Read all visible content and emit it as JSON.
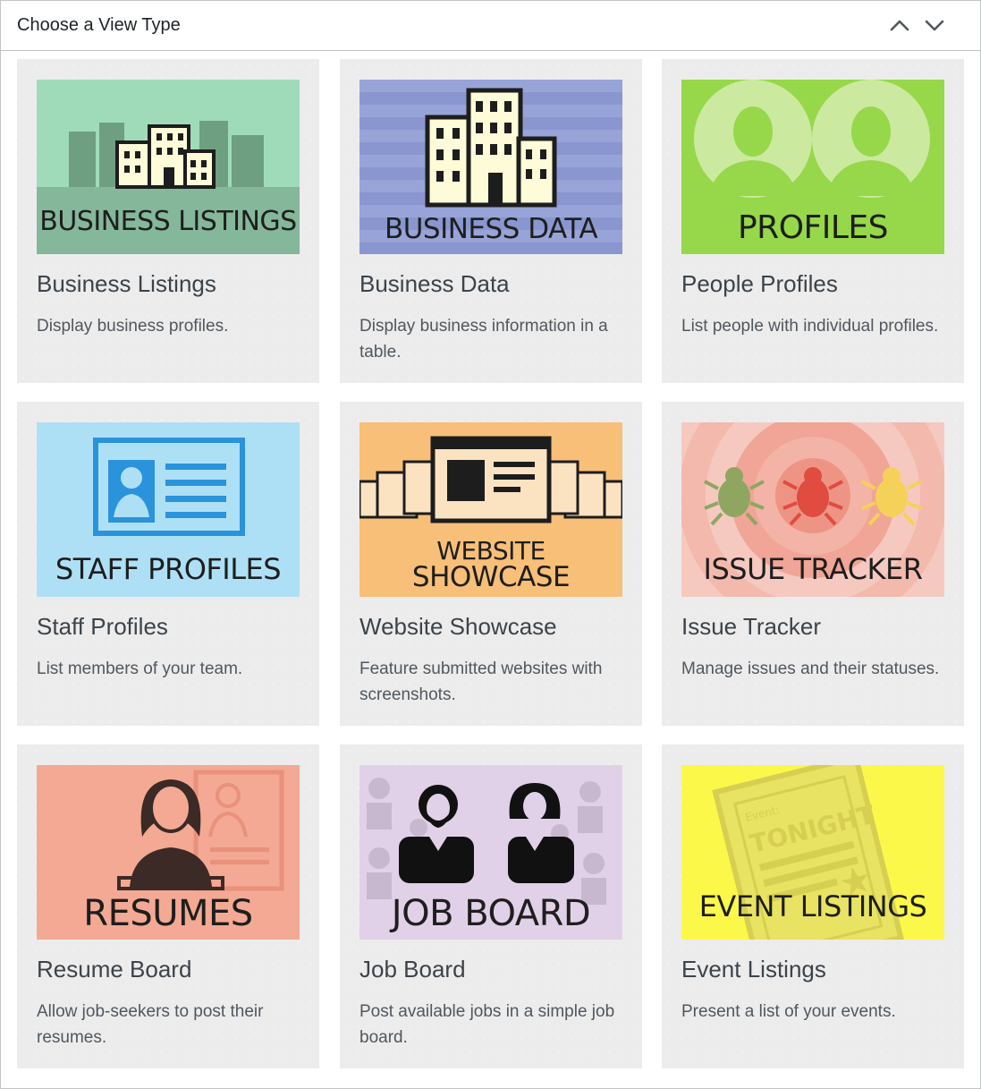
{
  "header": {
    "title": "Choose a View Type",
    "collapse_up_icon": "chevron-up-icon",
    "collapse_down_icon": "chevron-down-icon"
  },
  "cards": [
    {
      "thumb_label": "BUSINESS LISTINGS",
      "title": "Business Listings",
      "desc": "Display business profiles.",
      "bg": "#9fdbb8"
    },
    {
      "thumb_label": "BUSINESS DATA",
      "title": "Business Data",
      "desc": "Display business information in a table.",
      "bg": "#8a96cf"
    },
    {
      "thumb_label": "PROFILES",
      "title": "People Profiles",
      "desc": "List people with individual profiles.",
      "bg": "#96d84a"
    },
    {
      "thumb_label": "STAFF PROFILES",
      "title": "Staff Profiles",
      "desc": "List members of your team.",
      "bg": "#aee0f5"
    },
    {
      "thumb_label_1": "WEBSITE",
      "thumb_label_2": "SHOWCASE",
      "title": "Website Showcase",
      "desc": "Feature submitted websites with screenshots.",
      "bg": "#f8bf78"
    },
    {
      "thumb_label": "ISSUE TRACKER",
      "title": "Issue Tracker",
      "desc": "Manage issues and their statuses.",
      "bg": "#f6c9c0"
    },
    {
      "thumb_label": "RESUMES",
      "title": "Resume Board",
      "desc": "Allow job-seekers to post their resumes.",
      "bg": "#f3a993"
    },
    {
      "thumb_label": "JOB BOARD",
      "title": "Job Board",
      "desc": "Post available jobs in a simple job board.",
      "bg": "#e1d1e8"
    },
    {
      "thumb_label": "EVENT LISTINGS",
      "thumb_sub_1": "Event:",
      "thumb_sub_2": "TONIGHT",
      "title": "Event Listings",
      "desc": "Present a list of your events.",
      "bg": "#fbf84a"
    }
  ]
}
